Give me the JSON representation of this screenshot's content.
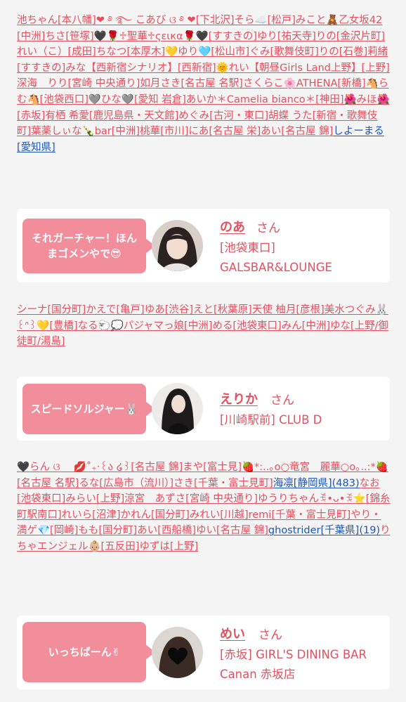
{
  "blocks": [
    {
      "items": [
        "池ちゃん[本八幡]❤︎ ࿔ ࿐ こあび ଓ ࿔ ❤︎[下北沢]そら☁️[松戸]みこと🧸乙女坂42[中洲]ちさ[笹塚]🖤🌹♱聖華♱ςειкα🌹🖤[すすきの]ゆり[祐天寺]りの[金沢片町]れい（こ）[成田]ちなつ[本厚木]💛ゆり🩵[松山市]ぐみ[歌舞伎町]りの[石巻]莉緒[すすきの]みな【西新宿シナリオ】[西新宿]🌞れい【朝昼Girls Land上野】[上野]深海　りり[宮崎 中央通り]如月さき[名古屋 名駅]さくらこ🌸ATHENA[新橋]🐴らむ🐴[池袋西口]🩶ひな🩶[愛知 岩倉]あいか＊Camelia bianco＊[神田]🌺みほ🌺[赤坂]有栖 希愛[鹿児島県・天文館]めぐみ[古河・東口]胡蝶 うた[新宿・歌舞伎町]葉薬しぃな🍾bar[中洲]桃華[市川]にあ[名古屋 栄]あい[名古屋 錦]",
        "しよーまる[愛知県]"
      ]
    },
    {
      "items": [
        "シーナ[国分町]かえで[亀戸]ゆあ[渋谷]えと[秋葉原]天使 柚月[彦根]美水つぐみ🐰꒰ᐢ꒱💛[豊橋]なる🐑💭パジャマっ娘[中洲]める[池袋東口]みん[中洲]ゆな[上野/御徒町/湯島]"
      ]
    },
    {
      "items": [
        "🖤らん ଓ 　💋˚₊‧꒰ა ໒꒱[名古屋 錦]まや[富士見]🍓*:..｡o○竜宮　麗華○o｡..:*🍓[名古屋 名駅]るな[広島市（流川）]さき[千葉・富士見町]",
        "海凛[静岡県](483)",
        "なお[池袋東口]みらい[上野]涼宮　あずさ[宮崎 中央通り]ゆうりちゃんꉂ•ᴗ•ꉂ⭐️[錦糸町駅南口]れいら[沼津]かれん[国分町]みれい[川越]remi[千葉・富士見町]やり・満ゲ💎[岡崎]もも[国分町]あい[西船橋]ゆい[名古屋 錦]",
        "ghostrider[千葉県](19)",
        "りちゃエンジェル👶🏼[五反田]ゆずは[上野]"
      ]
    }
  ],
  "cards": [
    {
      "bubble": "それガーチャー！ほんまゴメンやで😎",
      "name": "のあ",
      "san": "さん",
      "shop": "[池袋東口] GALSBAR&LOUNGE"
    },
    {
      "bubble": "スピードソルジャー🐰",
      "name": "えりか",
      "san": "さん",
      "shop": "[川崎駅前] CLUB D"
    },
    {
      "bubble": "いっちばーん✌",
      "name": "めい",
      "san": "さん",
      "shop": "[赤坂] GIRL'S DINING BAR Canan 赤坂店"
    }
  ]
}
